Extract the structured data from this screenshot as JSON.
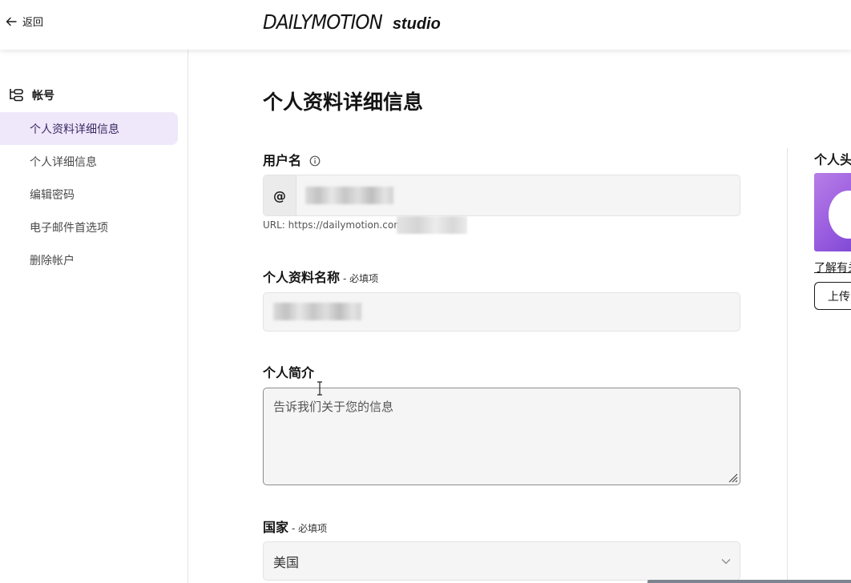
{
  "header": {
    "back_label": "返回",
    "logo_brand": "DAILYMOTION",
    "logo_suffix": "studio"
  },
  "sidebar": {
    "section_title": "帐号",
    "items": [
      {
        "label": "个人资料详细信息",
        "active": true
      },
      {
        "label": "个人详细信息",
        "active": false
      },
      {
        "label": "编辑密码",
        "active": false
      },
      {
        "label": "电子邮件首选项",
        "active": false
      },
      {
        "label": "删除帐户",
        "active": false
      }
    ]
  },
  "main": {
    "title": "个人资料详细信息",
    "username": {
      "label": "用户名",
      "prefix": "@",
      "url_prefix": "URL: https://dailymotion.com"
    },
    "profile_name": {
      "label": "个人资料名称",
      "required": "- 必填项"
    },
    "bio": {
      "label": "个人简介",
      "placeholder": "告诉我们关于您的信息"
    },
    "country": {
      "label": "国家",
      "required": "- 必填项",
      "selected": "美国"
    }
  },
  "avatar": {
    "label": "个人头",
    "learn_link": "了解有关",
    "upload_button": "上传"
  },
  "colors": {
    "active_nav_bg": "#efe8fb",
    "avatar_gradient": "#9a5de0"
  }
}
